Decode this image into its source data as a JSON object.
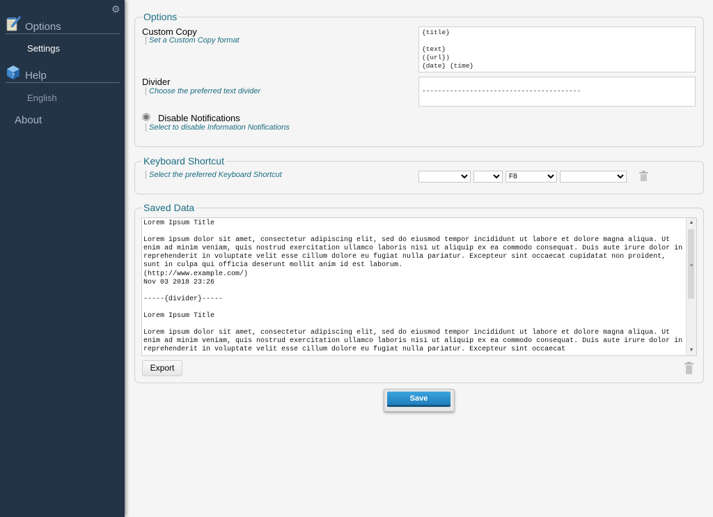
{
  "sidebar": {
    "options_label": "Options",
    "settings_label": "Settings",
    "help_label": "Help",
    "english_label": "English",
    "about_label": "About",
    "icons": {
      "gear": "gear-icon",
      "options": "notepad-pencil-icon",
      "help": "cube-icon"
    }
  },
  "options": {
    "legend": "Options",
    "custom_copy": {
      "label": "Custom Copy",
      "hint": "Set a Custom Copy format",
      "value": "{title}\n\n{text}\n({url})\n{date} {time}"
    },
    "divider": {
      "label": "Divider",
      "hint": "Choose the preferred text divider",
      "value": "----------------------------------------"
    },
    "notifications": {
      "label": "Disable Notifications",
      "hint": "Select to disable Information Notifications"
    }
  },
  "keyboard": {
    "legend": "Keyboard Shortcut",
    "hint": "Select the preferred Keyboard Shortcut",
    "select1": "",
    "select2": "",
    "select3": "F8",
    "select4": ""
  },
  "saved": {
    "legend": "Saved Data",
    "text": "Lorem Ipsum Title\n\nLorem ipsum dolor sit amet, consectetur adipiscing elit, sed do eiusmod tempor incididunt ut labore et dolore magna aliqua. Ut enim ad minim veniam, quis nostrud exercitation ullamco laboris nisi ut aliquip ex ea commodo consequat. Duis aute irure dolor in reprehenderit in voluptate velit esse cillum dolore eu fugiat nulla pariatur. Excepteur sint occaecat cupidatat non proident, sunt in culpa qui officia deserunt mollit anim id est laborum.\n(http://www.example.com/)\nNov 03 2018 23:26\n\n-----{divider}-----\n\nLorem Ipsum Title\n\nLorem ipsum dolor sit amet, consectetur adipiscing elit, sed do eiusmod tempor incididunt ut labore et dolore magna aliqua. Ut enim ad minim veniam, quis nostrud exercitation ullamco laboris nisi ut aliquip ex ea commodo consequat. Duis aute irure dolor in reprehenderit in voluptate velit esse cillum dolore eu fugiat nulla pariatur. Excepteur sint occaecat",
    "export_label": "Export"
  },
  "save_label": "Save",
  "colors": {
    "sidebar": "#243447",
    "accent": "#1a6d82",
    "save_button": "#2a8fc8"
  }
}
